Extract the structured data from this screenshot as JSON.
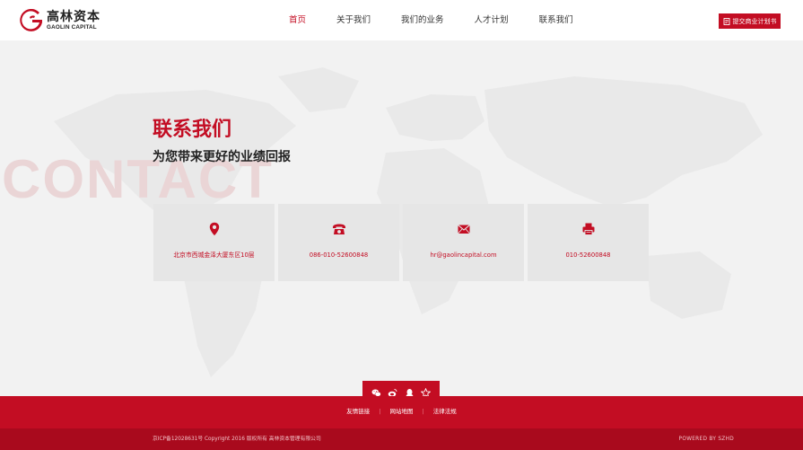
{
  "header": {
    "logo": {
      "cn": "高林资本",
      "en": "GAOLIN CAPITAL"
    },
    "nav": [
      {
        "label": "首页",
        "active": true
      },
      {
        "label": "关于我们",
        "active": false
      },
      {
        "label": "我们的业务",
        "active": false
      },
      {
        "label": "人才计划",
        "active": false
      },
      {
        "label": "联系我们",
        "active": false
      }
    ],
    "submit_label": "提交商业计划书"
  },
  "main": {
    "background_word": "CONTACT",
    "title": "联系我们",
    "subtitle": "为您带来更好的业绩回报",
    "cards": [
      {
        "icon": "location-pin-icon",
        "text": "北京市西城金泽大厦东区10层"
      },
      {
        "icon": "telephone-icon",
        "text": "086-010-52600848"
      },
      {
        "icon": "envelope-icon",
        "text": "hr@gaolincapital.com"
      },
      {
        "icon": "fax-printer-icon",
        "text": "010-52600848"
      }
    ]
  },
  "social": [
    "wechat-icon",
    "weibo-icon",
    "qq-icon",
    "star-icon"
  ],
  "footer": {
    "links": [
      "友情链接",
      "网站地图",
      "法律法规"
    ],
    "copyright": "京ICP备12028631号    Copyright 2016 版权所有 高林资本管理有限公司",
    "powered": "POWERED BY SZHD"
  },
  "colors": {
    "brand": "#c30d23",
    "brand_dark": "#a90a1d",
    "background": "#f2f2f2",
    "card": "#e6e6e6"
  }
}
